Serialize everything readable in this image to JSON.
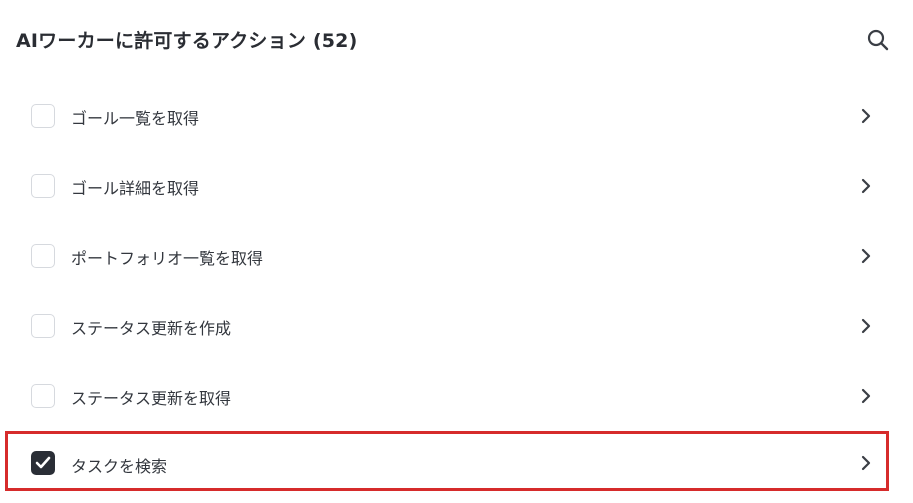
{
  "header": {
    "title": "AIワーカーに許可するアクション (52)",
    "search_icon": "search-icon"
  },
  "actions": [
    {
      "label": "ゴール一覧を取得",
      "checked": false
    },
    {
      "label": "ゴール詳細を取得",
      "checked": false
    },
    {
      "label": "ポートフォリオ一覧を取得",
      "checked": false
    },
    {
      "label": "ステータス更新を作成",
      "checked": false
    },
    {
      "label": "ステータス更新を取得",
      "checked": false
    },
    {
      "label": "タスクを検索",
      "checked": true,
      "highlighted": true
    }
  ],
  "colors": {
    "highlight_border": "#d62b2b",
    "checkbox_checked": "#2a2e36",
    "checkbox_border": "#d6d9de"
  }
}
